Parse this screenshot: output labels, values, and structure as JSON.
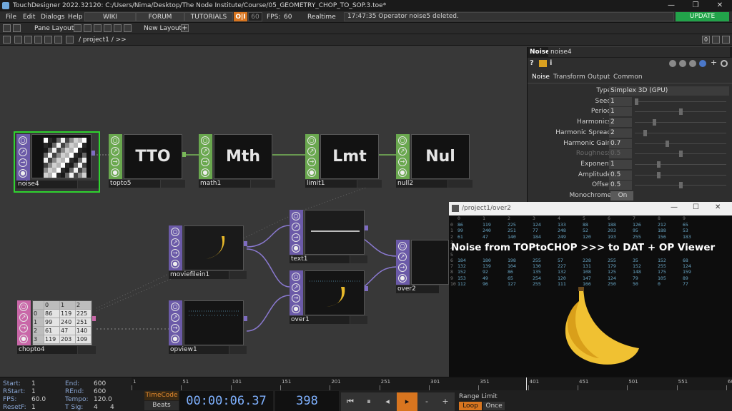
{
  "window": {
    "title": "TouchDesigner 2022.32120: C:/Users/Nima/Desktop/The Node Institute/Course/05_GEOMETRY_CHOP_TO_SOP.3.toe*",
    "minimize": "—",
    "restore": "❐",
    "close": "✕"
  },
  "menubar": {
    "items": [
      "File",
      "Edit",
      "Dialogs",
      "Help"
    ],
    "wiki": "WIKI",
    "forum": "FORUM",
    "tutorials": "TUTORIALS",
    "oi": "O|I",
    "fps_box": "60",
    "fps_label": "FPS:",
    "fps_value": "60",
    "realtime": "Realtime",
    "status": "17:47:35 Operator noise5 deleted.",
    "update": "UPDATE"
  },
  "toolbar": {
    "pane_layout": "Pane Layout",
    "new_layout": "New Layout",
    "plus": "+"
  },
  "pathbar": {
    "path": "/ project1 / >>",
    "zero": "0"
  },
  "nodes": {
    "noise4": "noise4",
    "topto5": "topto5",
    "topto5_text": "TTO",
    "math1": "math1",
    "math1_text": "Mth",
    "limit1": "limit1",
    "limit1_text": "Lmt",
    "null2": "null2",
    "null2_text": "Nul",
    "moviefilein1": "moviefilein1",
    "text1": "text1",
    "over1": "over1",
    "over2": "over2",
    "chopto4": "chopto4",
    "opview1": "opview1",
    "chopto_grid": [
      [
        "",
        "0",
        "1",
        "2"
      ],
      [
        "0",
        "86",
        "119",
        "225"
      ],
      [
        "1",
        "99",
        "240",
        "251"
      ],
      [
        "2",
        "61",
        "47",
        "140"
      ],
      [
        "3",
        "119",
        "203",
        "109"
      ]
    ]
  },
  "params": {
    "op_type": "Noise",
    "op_name": "noise4",
    "icons": [
      "?",
      "i"
    ],
    "tabs": [
      "Noise",
      "Transform",
      "Output",
      "Common"
    ],
    "rows": [
      {
        "label": "Type",
        "value": "Simplex 3D (GPU)"
      },
      {
        "label": "Seed",
        "value": "1",
        "knob": 0.0
      },
      {
        "label": "Period",
        "value": "1",
        "knob": 0.5
      },
      {
        "label": "Harmonics",
        "value": "2",
        "knob": 0.2
      },
      {
        "label": "Harmonic Spread",
        "value": "2",
        "knob": 0.1
      },
      {
        "label": "Harmonic Gain",
        "value": "0.7",
        "knob": 0.35
      },
      {
        "label": "Roughness",
        "value": "0.5",
        "knob": 0.5,
        "disabled": true
      },
      {
        "label": "Exponent",
        "value": "1",
        "knob": 0.25
      },
      {
        "label": "Amplitude",
        "value": "0.5",
        "knob": 0.25
      },
      {
        "label": "Offset",
        "value": "0.5",
        "knob": 0.5
      },
      {
        "label": "Monochrome",
        "value": "On"
      }
    ]
  },
  "viewer": {
    "title": "/project1/over2",
    "caption": "Noise from TOPtoCHOP >>> to DAT + OP Viewer",
    "header": [
      "",
      "0",
      "1",
      "2",
      "3",
      "4",
      "5",
      "6",
      "7",
      "8",
      "9"
    ],
    "rows": [
      [
        "0",
        "86",
        "119",
        "225",
        "124",
        "133",
        "88",
        "188",
        "126",
        "212",
        "65"
      ],
      [
        "1",
        "99",
        "240",
        "251",
        "77",
        "248",
        "52",
        "203",
        "95",
        "188",
        "53"
      ],
      [
        "2",
        "61",
        "47",
        "140",
        "184",
        "249",
        "120",
        "193",
        "255",
        "156",
        "183"
      ],
      [
        "3",
        "",
        "",
        "",
        "",
        "",
        "",
        "",
        "",
        "",
        ""
      ],
      [
        "4",
        "",
        "",
        "",
        "",
        "",
        "",
        "",
        "",
        "",
        ""
      ],
      [
        "5",
        "",
        "",
        "",
        "",
        "",
        "",
        "",
        "",
        "",
        ""
      ],
      [
        "6",
        "184",
        "180",
        "198",
        "255",
        "57",
        "228",
        "255",
        "35",
        "152",
        "68"
      ],
      [
        "7",
        "132",
        "139",
        "104",
        "130",
        "227",
        "131",
        "179",
        "152",
        "255",
        "124"
      ],
      [
        "8",
        "152",
        "92",
        "86",
        "135",
        "132",
        "108",
        "125",
        "148",
        "175",
        "159"
      ],
      [
        "9",
        "153",
        "49",
        "65",
        "254",
        "120",
        "147",
        "124",
        "79",
        "105",
        "89"
      ],
      [
        "10",
        "112",
        "96",
        "127",
        "255",
        "111",
        "166",
        "250",
        "50",
        "0",
        "77"
      ]
    ]
  },
  "bottom": {
    "start_label": "Start:",
    "start": "1",
    "rstart_label": "RStart:",
    "rstart": "1",
    "fps_label": "FPS:",
    "fps": "60.0",
    "resetf_label": "ResetF:",
    "resetf": "1",
    "end_label": "End:",
    "end": "600",
    "rend_label": "REnd:",
    "rend": "600",
    "tempo_label": "Tempo:",
    "tempo": "120.0",
    "tsig_label": "T Sig:",
    "tsig_a": "4",
    "tsig_b": "4",
    "timecode": "TimeCode",
    "beats": "Beats",
    "time": "00:00:06.37",
    "frame": "398",
    "ticks": [
      "1",
      "51",
      "101",
      "151",
      "201",
      "251",
      "301",
      "351",
      "401",
      "451",
      "501",
      "551",
      "600"
    ],
    "range_limit": "Range Limit",
    "loop": "Loop",
    "once": "Once",
    "play_progress": 0.663
  }
}
